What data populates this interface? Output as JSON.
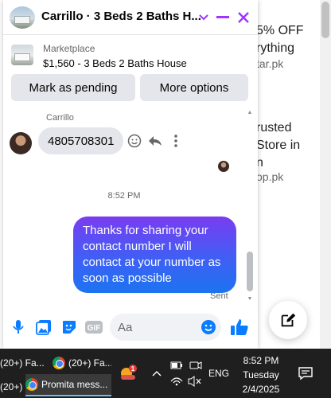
{
  "background_page": {
    "ad1_line1": "5% OFF",
    "ad1_line2": "rything",
    "ad1_source": "tar.pk",
    "ad2_line1": "rusted",
    "ad2_line2": "Store in",
    "ad2_line3": "n",
    "ad2_source": "op.pk"
  },
  "chat": {
    "title": "Carrillo · 3 Beds 2 Baths H...",
    "header_icons": [
      "chevron-down-icon",
      "minimize-icon",
      "close-icon"
    ],
    "accent_color": "#a033ff",
    "listing": {
      "label": "Marketplace",
      "title": "$1,560 - 3 Beds 2 Baths House",
      "mark_pending_label": "Mark as pending",
      "more_options_label": "More options"
    },
    "messages": {
      "sender_name": "Carrillo",
      "incoming_text": "4805708301",
      "timestamp": "8:52 PM",
      "outgoing_text": "Thanks for sharing your contact number I will contact at your number as soon as possible",
      "status": "Sent"
    },
    "composer": {
      "placeholder": "Aa",
      "value": ""
    },
    "colors": {
      "bubble_out_start": "#7a3cf0",
      "bubble_out_end": "#1b74f0",
      "bubble_in": "#e4e6eb",
      "composer_icon": "#0a7cff"
    }
  },
  "taskbar": {
    "items": [
      {
        "label": "(20+) Fa..."
      },
      {
        "label": "(20+) Fa..."
      },
      {
        "label": "(20+) Fa..."
      },
      {
        "label": "Promita mess..."
      }
    ],
    "weather_badge": "1",
    "language": "ENG",
    "time": "8:52 PM",
    "day": "Tuesday",
    "date": "2/4/2025"
  }
}
